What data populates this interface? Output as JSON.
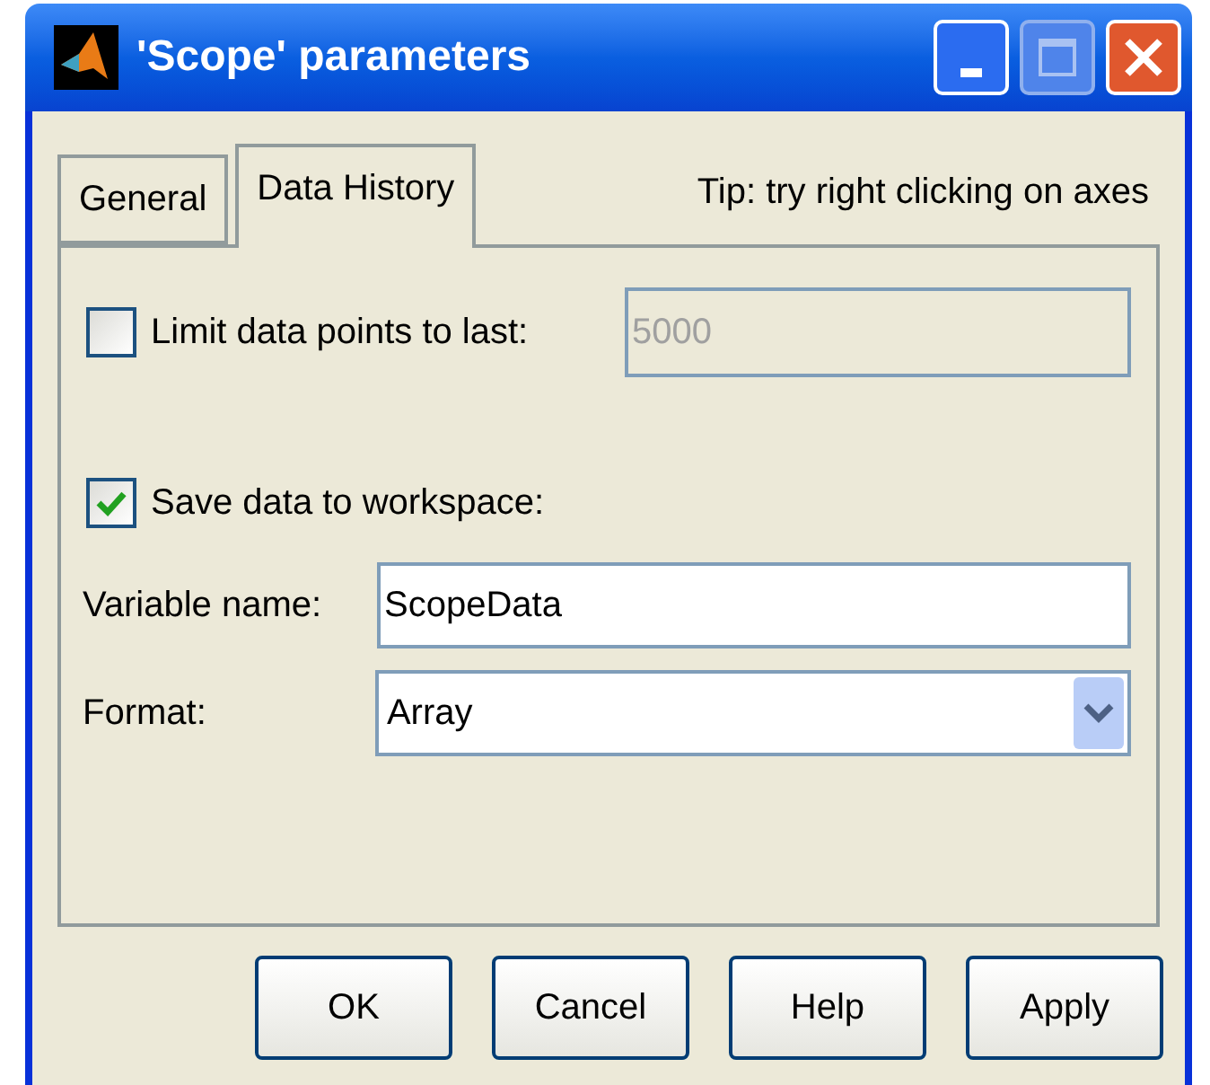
{
  "window": {
    "title": "'Scope' parameters"
  },
  "tabs": [
    {
      "label": "General",
      "selected": false
    },
    {
      "label": "Data History",
      "selected": true
    }
  ],
  "tip": "Tip: try right clicking on axes",
  "limit": {
    "label": "Limit data points to last:",
    "checked": false,
    "value": "5000",
    "disabled": true
  },
  "save": {
    "label": "Save data to workspace:",
    "checked": true
  },
  "variable_name": {
    "label": "Variable name:",
    "value": "ScopeData"
  },
  "format": {
    "label": "Format:",
    "value": "Array"
  },
  "buttons": [
    "OK",
    "Cancel",
    "Help",
    "Apply"
  ]
}
